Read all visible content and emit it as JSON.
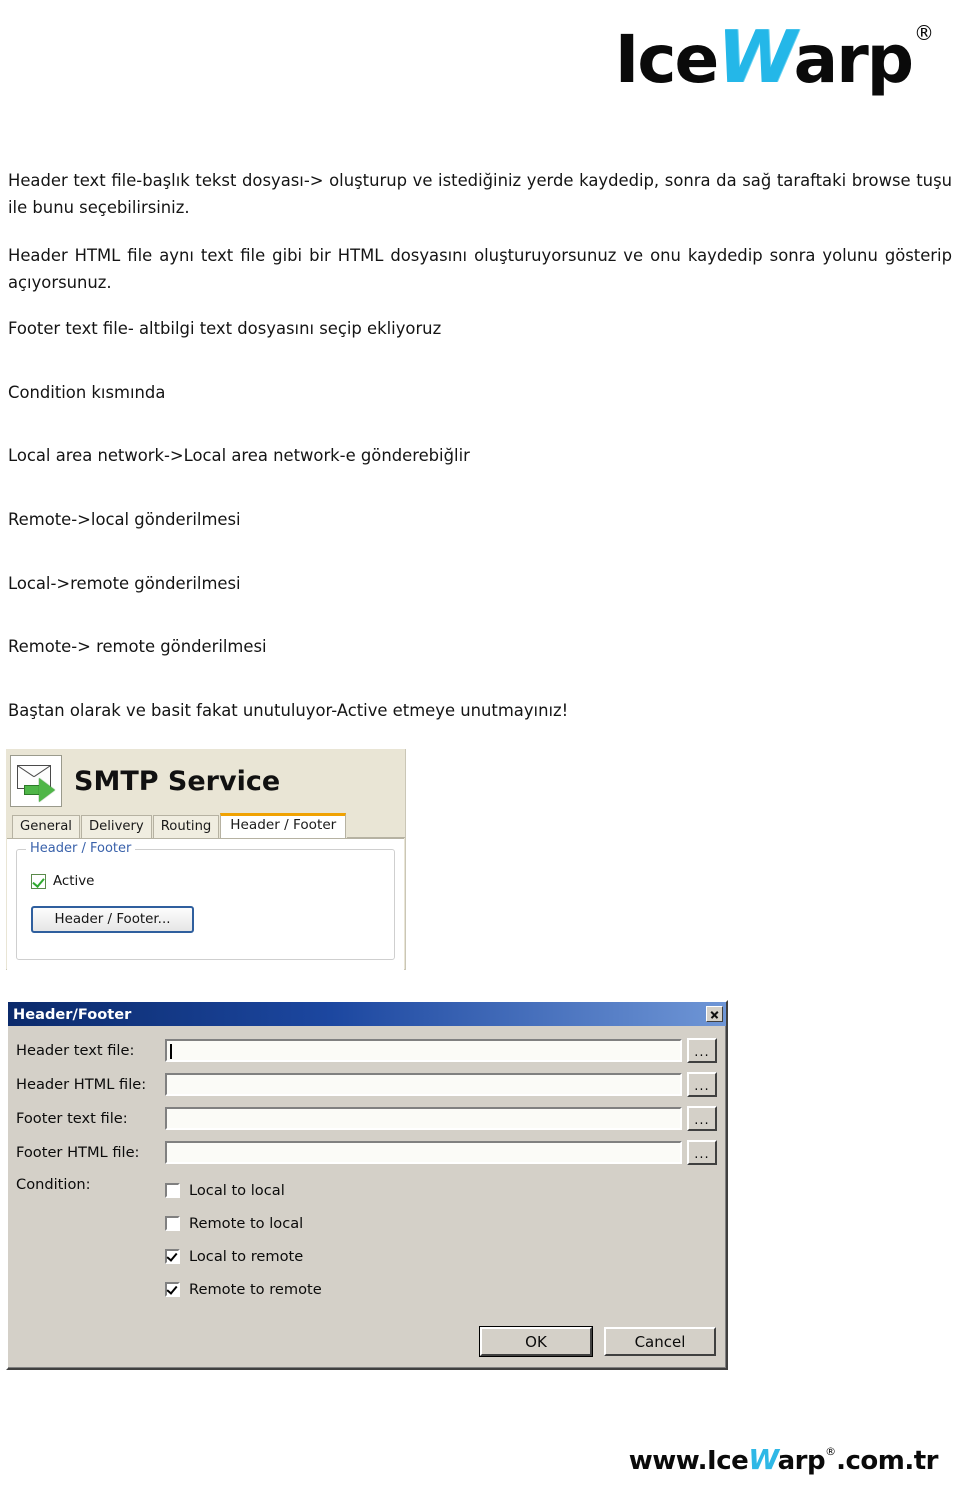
{
  "brand": {
    "logo_part1": "Ice",
    "logo_part2": "W",
    "logo_part3": "arp",
    "logo_trademark": "®",
    "accent_color": "#24b7e8"
  },
  "document": {
    "paragraphs": [
      "Header text file-başlık tekst dosyası-> oluşturup ve istediğiniz yerde kaydedip, sonra da sağ taraftaki browse tuşu ile bunu seçebilirsiniz.",
      "Header HTML file aynı text file gibi bir HTML dosyasını oluşturuyorsunuz ve onu kaydedip sonra yolunu gösterip açıyorsunuz.",
      "Footer text file- altbilgi text dosyasını seçip ekliyoruz",
      "Condition kısmında",
      "Local area network->Local area network-e gönderebiğlir",
      "Remote->local gönderilmesi",
      "Local->remote gönderilmesi",
      "Remote-> remote gönderilmesi",
      "Baştan olarak ve basit fakat unutuluyor-Active etmeye unutmayınız!"
    ]
  },
  "smtp_panel": {
    "title": "SMTP Service",
    "icon_name": "envelope-send-icon",
    "tabs": [
      {
        "label": "General",
        "active": false
      },
      {
        "label": "Delivery",
        "active": false
      },
      {
        "label": "Routing",
        "active": false
      },
      {
        "label": "Header / Footer",
        "active": true
      }
    ],
    "active_tab_accent": "#f0a202",
    "panel_background": "#e9e5d5",
    "groupbox": {
      "label": "Header / Footer",
      "label_color": "#3a62ab",
      "active_checkbox": {
        "label": "Active",
        "checked": true
      },
      "button_label": "Header / Footer..."
    }
  },
  "hf_dialog": {
    "title": "Header/Footer",
    "close_label": "Close",
    "fields": [
      {
        "label": "Header text file:",
        "value": "",
        "focused": true,
        "browse_label": "..."
      },
      {
        "label": "Header HTML file:",
        "value": "",
        "focused": false,
        "browse_label": "..."
      },
      {
        "label": "Footer text file:",
        "value": "",
        "focused": false,
        "browse_label": "..."
      },
      {
        "label": "Footer HTML file:",
        "value": "",
        "focused": false,
        "browse_label": "..."
      }
    ],
    "condition": {
      "label": "Condition:",
      "options": [
        {
          "label": "Local to local",
          "checked": false
        },
        {
          "label": "Remote to local",
          "checked": false
        },
        {
          "label": "Local to remote",
          "checked": true
        },
        {
          "label": "Remote to remote",
          "checked": true
        }
      ]
    },
    "buttons": {
      "ok": "OK",
      "cancel": "Cancel"
    },
    "titlebar_color": "#1c47a0"
  },
  "footer": {
    "prefix": "www.Ice",
    "accent": "W",
    "mid": "arp",
    "trademark": "®",
    "suffix": ".com.tr"
  }
}
